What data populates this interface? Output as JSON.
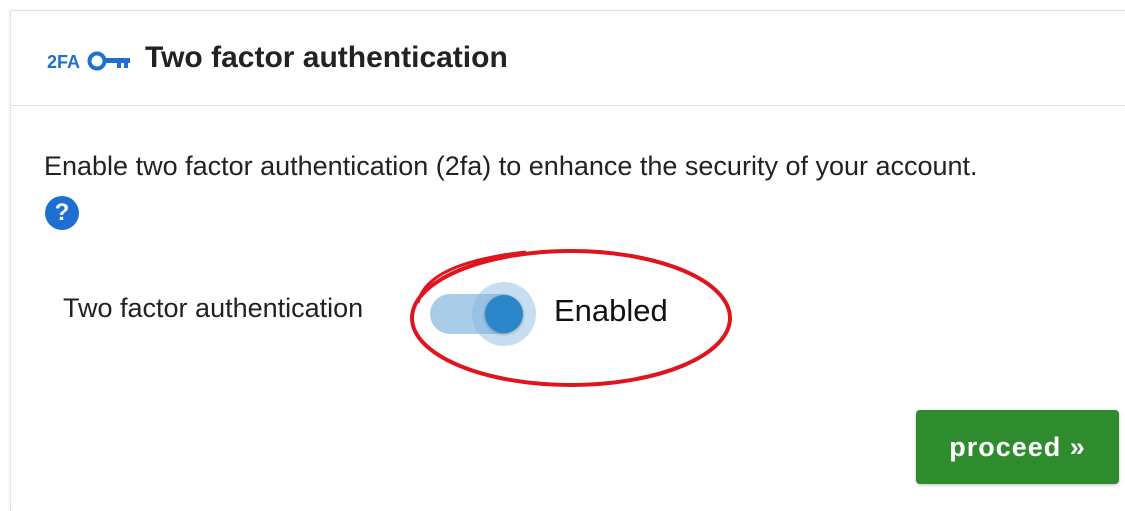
{
  "header": {
    "icon_text": "2FA",
    "icon_name": "key-icon",
    "title": "Two factor authentication"
  },
  "body": {
    "description": "Enable two factor authentication (2fa) to enhance the security of your account.",
    "help_icon": "?",
    "field_label": "Two factor authentication",
    "toggle_state": "Enabled",
    "toggle_on": true
  },
  "footer": {
    "proceed_label": "proceed »"
  },
  "colors": {
    "icon_blue": "#1e6fd0",
    "toggle_track": "#a9cde9",
    "toggle_knob": "#2a86c8",
    "proceed_green": "#2e8b2e",
    "annotation_red": "#e0141e"
  }
}
